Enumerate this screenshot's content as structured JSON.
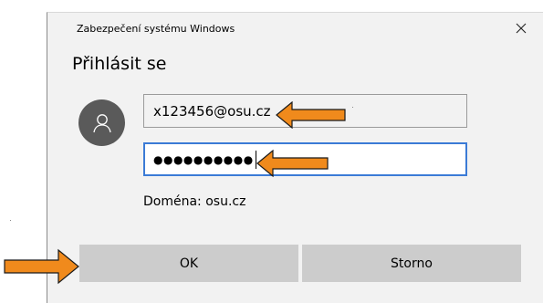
{
  "window": {
    "title": "Zabezpečení systému Windows",
    "close_icon": "close-icon"
  },
  "dialog": {
    "heading": "Přihlásit se"
  },
  "user": {
    "avatar_icon": "user-icon"
  },
  "username_field": {
    "value": "x123456@osu.cz"
  },
  "password_field": {
    "masked_value": "●●●●●●●●●●"
  },
  "domain": {
    "label": "Doména: osu.cz"
  },
  "buttons": {
    "ok_label": "OK",
    "cancel_label": "Storno"
  },
  "annotations": {
    "arrow_color": "#f08a1c",
    "arrow_outline": "#1a1a1a",
    "icons": [
      "arrow-left-icon",
      "arrow-left-icon",
      "arrow-right-icon"
    ]
  },
  "colors": {
    "dialog_bg": "#f2f2f2",
    "focus_border": "#3b7bd6",
    "button_bg": "#cccccc",
    "avatar_bg": "#5a5a5a"
  }
}
